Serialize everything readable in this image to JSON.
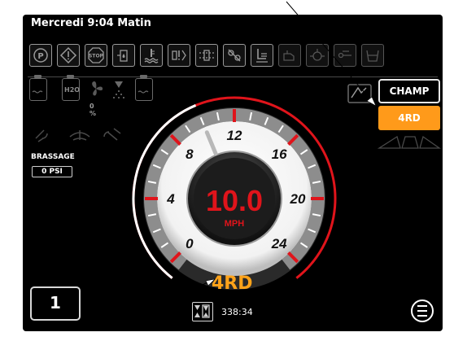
{
  "header": {
    "datetime": "Mercredi 9:04 Matin"
  },
  "toolbar": {
    "icons": [
      "parking-brake-icon",
      "warning-icon",
      "stop-icon",
      "fuel-filter-icon",
      "coolant-temp-icon",
      "transmission-warning-icon",
      "hydraulic-icon",
      "belt-icon",
      "seat-icon",
      "oil-icon",
      "pressure-icon",
      "fuel-filter-water-icon",
      "tank-icon"
    ],
    "stop_text": "STOP"
  },
  "left_panel": {
    "battery_h2o_label": "H2O",
    "fan_percent": "0 %",
    "brassage_label": "BRASSAGE",
    "pressure_value": "0 PSI"
  },
  "mode": {
    "champ_label": "CHAMP",
    "drive_label": "4RD"
  },
  "gauge": {
    "speed": "10.0",
    "unit": "MPH",
    "ticks": [
      "0",
      "4",
      "8",
      "12",
      "16",
      "20",
      "24"
    ],
    "max": 24,
    "value": 10.0,
    "gear": "4RD"
  },
  "footer": {
    "gear_number": "1",
    "timer": "338:34"
  },
  "colors": {
    "accent": "#ff9a1a",
    "red": "#e0141b",
    "background": "#000000"
  }
}
